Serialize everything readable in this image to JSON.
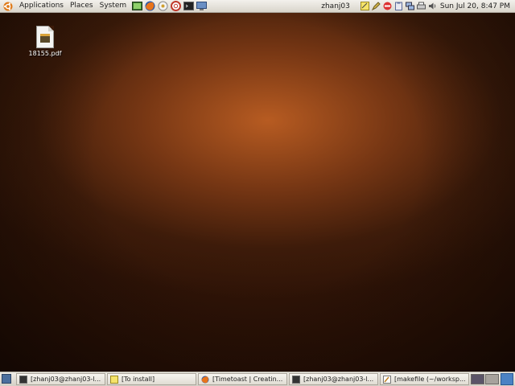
{
  "top_panel": {
    "menus": [
      "Applications",
      "Places",
      "System"
    ],
    "launchers": [
      "terminal-launcher-icon",
      "firefox-icon",
      "evolution-icon",
      "help-icon",
      "terminal-icon",
      "monitor-icon"
    ],
    "username": "zhanj03",
    "clock": "Sun Jul 20,  8:47 PM"
  },
  "desktop": {
    "icons": [
      {
        "label": "18155.pdf",
        "icon": "pdf-file-icon"
      }
    ]
  },
  "taskbar": {
    "tasks": [
      {
        "label": "[zhanj03@zhanj03-l...",
        "icon": "terminal-icon"
      },
      {
        "label": "[To install]",
        "icon": "note-icon"
      },
      {
        "label": "[Timetoast | Creatin...",
        "icon": "firefox-icon"
      },
      {
        "label": "[zhanj03@zhanj03-l...",
        "icon": "terminal-icon"
      },
      {
        "label": "[makefile (~/worksp...",
        "icon": "editor-icon"
      }
    ]
  },
  "colors": {
    "panel": "#dcd8cf",
    "workspace_active": "#5b5468",
    "workspace_inactive": "#a7a29d",
    "trash": "#4b82c4"
  }
}
